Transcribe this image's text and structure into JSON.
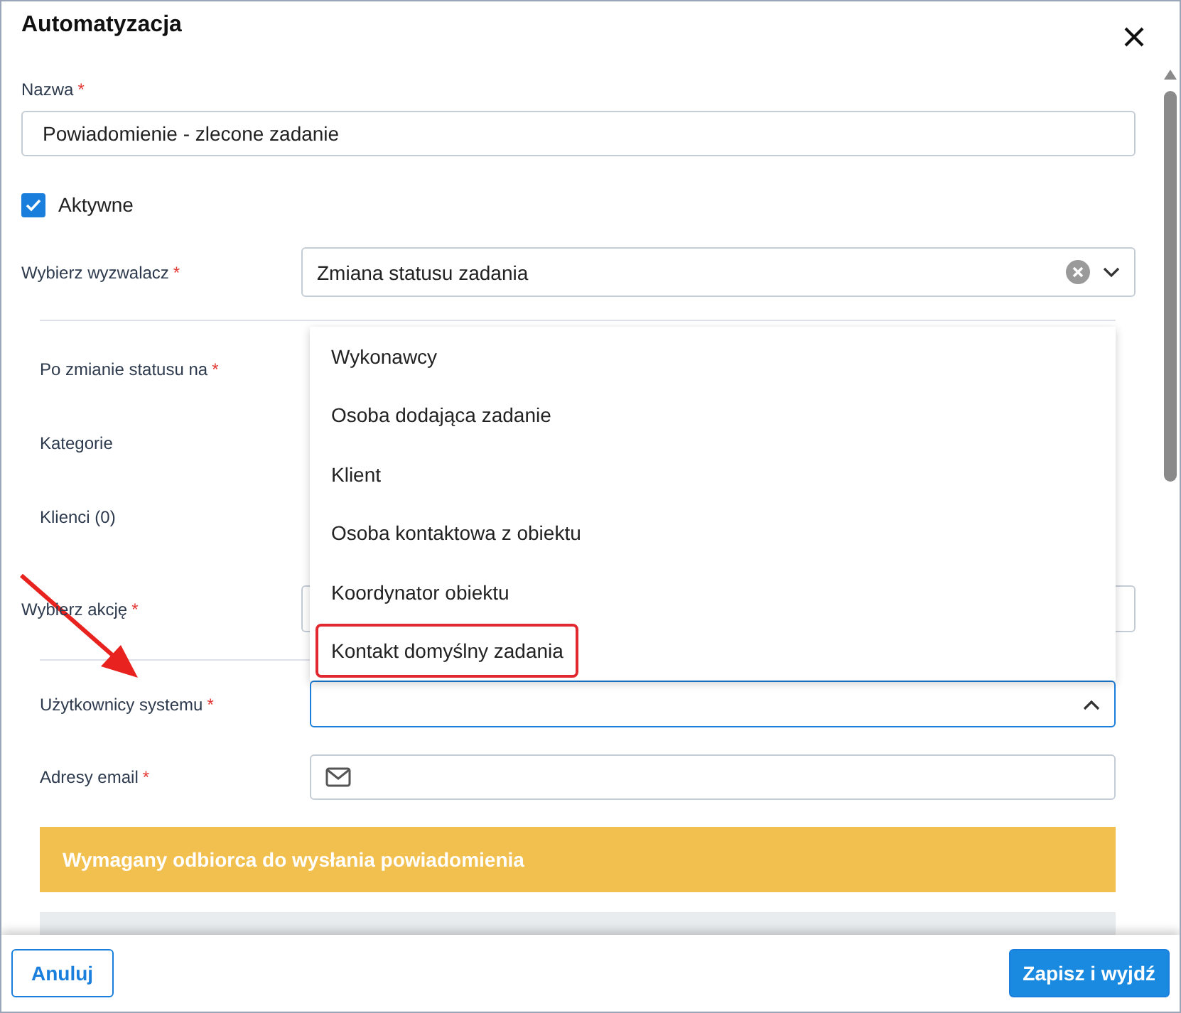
{
  "dialog": {
    "title": "Automatyzacja"
  },
  "name_field": {
    "label": "Nazwa",
    "mark": "*",
    "value": "Powiadomienie - zlecone zadanie"
  },
  "active": {
    "label": "Aktywne",
    "checked": true
  },
  "trigger": {
    "label": "Wybierz wyzwalacz",
    "mark": "*",
    "value": "Zmiana statusu zadania"
  },
  "trigger_options": [
    {
      "label": "Po zmianie statusu na",
      "mark": "*"
    },
    {
      "label": "Kategorie"
    },
    {
      "label": "Klienci (0)"
    }
  ],
  "action": {
    "label": "Wybierz akcję",
    "mark": "*"
  },
  "recipients": [
    {
      "label": "Użytkownicy systemu",
      "mark": "*",
      "kind": "select",
      "expanded": true
    },
    {
      "label": "Adresy email",
      "mark": "*",
      "kind": "email"
    }
  ],
  "dropdown_options": [
    {
      "label": "Wykonawcy",
      "highlighted": false
    },
    {
      "label": "Osoba dodająca zadanie",
      "highlighted": false
    },
    {
      "label": "Klient",
      "highlighted": false
    },
    {
      "label": "Osoba kontaktowa z obiektu",
      "highlighted": false
    },
    {
      "label": "Koordynator obiektu",
      "highlighted": false
    },
    {
      "label": "Kontakt domyślny zadania",
      "highlighted": true
    }
  ],
  "warning": "Wymagany odbiorca do wysłania powiadomienia",
  "buttons": [
    {
      "label": "Anuluj",
      "kind": "secondary"
    },
    {
      "label": "Zapisz i wyjdź",
      "kind": "primary"
    }
  ]
}
